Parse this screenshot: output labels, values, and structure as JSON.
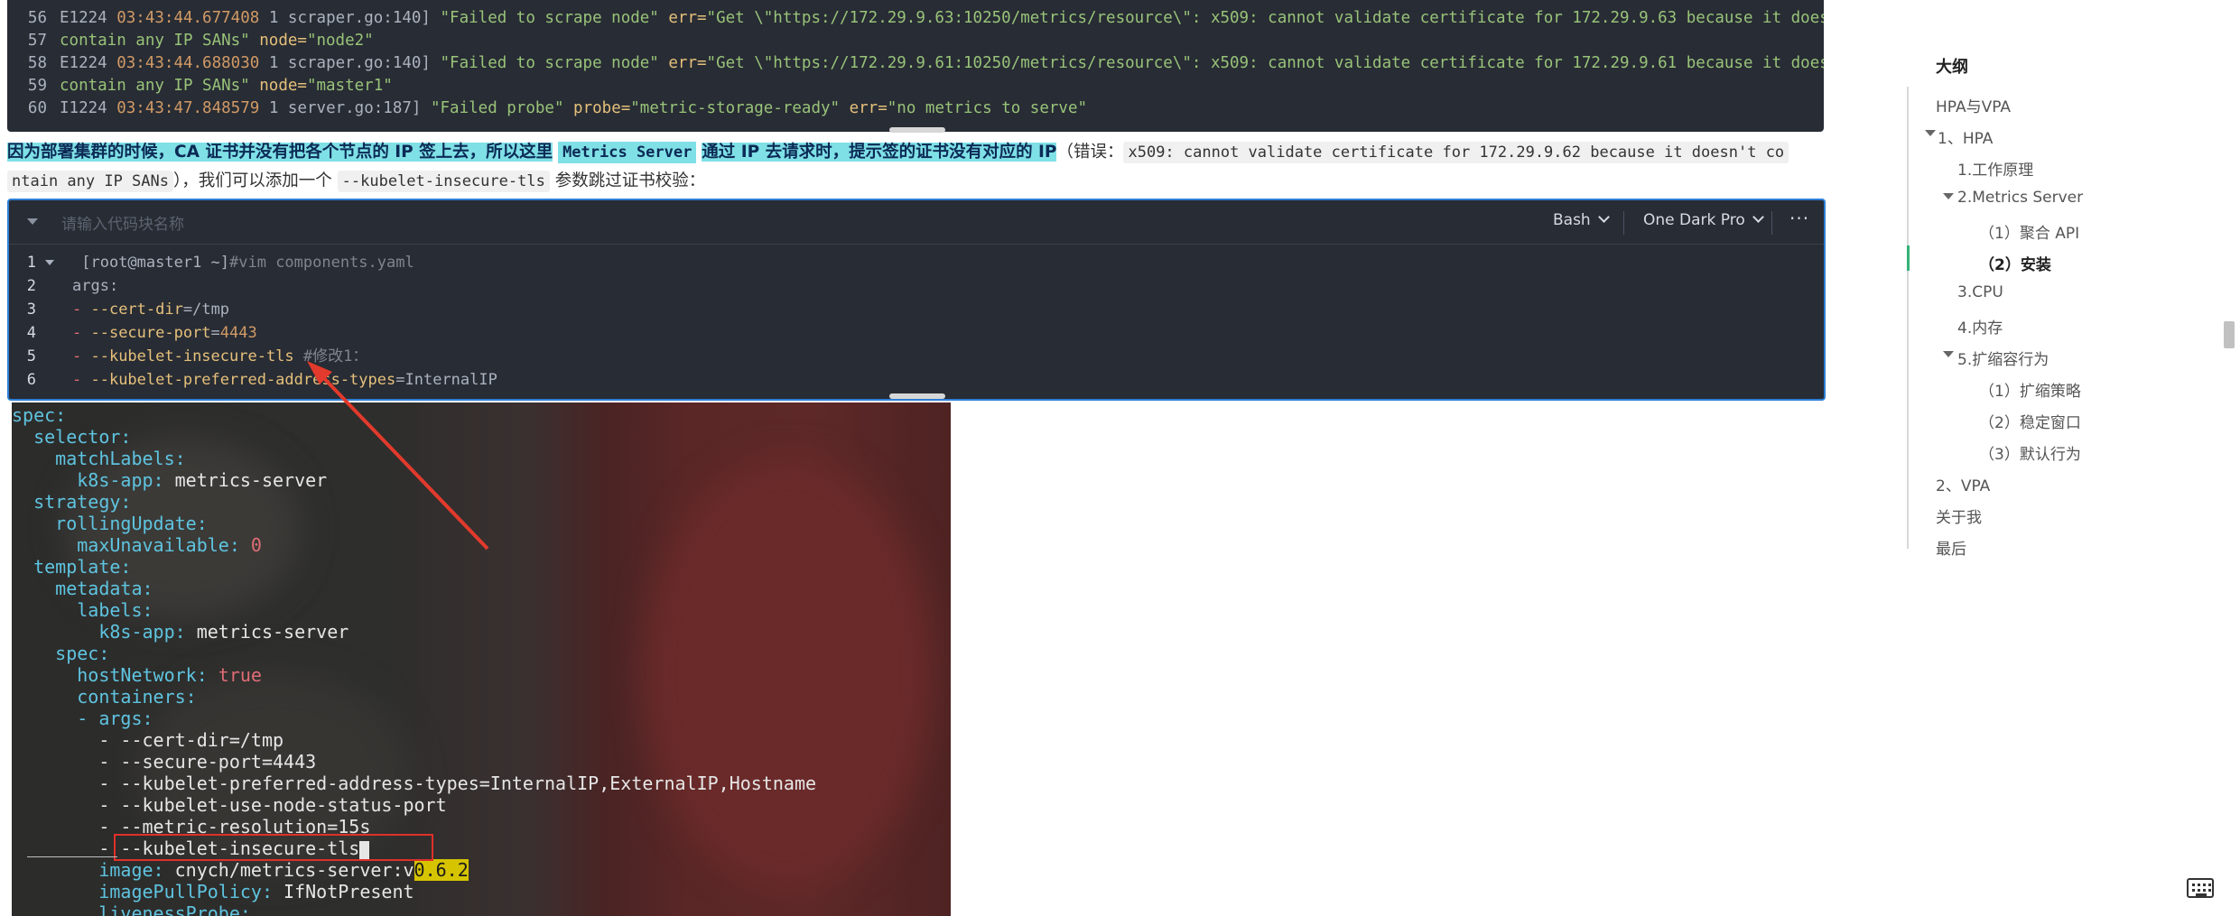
{
  "log": {
    "lines": [
      {
        "no": "56",
        "level": "E1224",
        "time": "03:43:44.677408",
        "pid": "1",
        "src": "scraper.go:140]",
        "msg": "\"Failed to scrape node\"",
        "errk": "err=",
        "errv": "\"Get \\\"https://172.29.9.63:10250/metrics/resource\\\": x509: cannot validate certificate for 172.29.9.63 because it doesn't",
        "cont": "contain any IP SANs\"",
        "nodek": "node=",
        "nodev": "\"node2\""
      },
      {
        "no": "58",
        "level": "E1224",
        "time": "03:43:44.688030",
        "pid": "1",
        "src": "scraper.go:140]",
        "msg": "\"Failed to scrape node\"",
        "errk": "err=",
        "errv": "\"Get \\\"https://172.29.9.61:10250/metrics/resource\\\": x509: cannot validate certificate for 172.29.9.61 because it doesn't",
        "cont": "contain any IP SANs\"",
        "nodek": "node=",
        "nodev": "\"master1\""
      }
    ],
    "cont_numbers": [
      "57",
      "59"
    ],
    "last": {
      "no": "60",
      "level": "I1224",
      "time": "03:43:47.848579",
      "pid": "1",
      "src": "server.go:187]",
      "msg": "\"Failed probe\"",
      "probek": "probe=",
      "probev": "\"metric-storage-ready\"",
      "errk": "err=",
      "errv": "\"no metrics to serve\""
    }
  },
  "paragraph": {
    "hl1": "因为部署集群的时候，CA 证书并没有把各个节点的 IP 签上去，所以这里",
    "code1": "Metrics Server",
    "hl2": "通过 IP 去请求时，提示签的证书没有对应的 IP",
    "t1": "（错误：",
    "code2a": "x509: cannot validate certificate for 172.29.9.62 because it doesn't co",
    "code2b": "ntain any IP SANs",
    "t2": "），我们可以添加一个",
    "code3": "--kubelet-insecure-tls",
    "t3": "参数跳过证书校验："
  },
  "code_block": {
    "name_placeholder": "请输入代码块名称",
    "language": "Bash",
    "theme": "One Dark Pro",
    "more": "···",
    "lines": [
      {
        "no": "1",
        "prompt": "[root@master1 ~]",
        "rest": "#vim components.yaml"
      },
      {
        "no": "2",
        "text": "args:"
      },
      {
        "no": "3",
        "dash": "- ",
        "opt": "--cert-dir",
        "eq": "=",
        "val": "/tmp"
      },
      {
        "no": "4",
        "dash": "- ",
        "opt": "--secure-port",
        "eq": "=",
        "val": "4443"
      },
      {
        "no": "5",
        "dash": "- ",
        "opt": "--kubelet-insecure-tls",
        "comment": " #修改1："
      },
      {
        "no": "6",
        "dash": "- ",
        "opt": "--kubelet-preferred-address-types",
        "eq": "=",
        "val": "InternalIP"
      }
    ]
  },
  "yaml": {
    "spec": "spec:",
    "selector": "selector:",
    "matchLabels": "matchLabels:",
    "k8sapp": "k8s-app:",
    "metricsServer": "metrics-server",
    "strategy": "strategy:",
    "rollingUpdate": "rollingUpdate:",
    "maxUnavailable": "maxUnavailable:",
    "zero": "0",
    "template": "template:",
    "metadata": "metadata:",
    "labels": "labels:",
    "spec2": "spec:",
    "hostNetwork": "hostNetwork:",
    "true": "true",
    "containers": "containers:",
    "args": "- args:",
    "a1": "- --cert-dir=/tmp",
    "a2": "- --secure-port=4443",
    "a3": "- --kubelet-preferred-address-types=InternalIP,ExternalIP,Hostname",
    "a4": "- --kubelet-use-node-status-port",
    "a5": "- --metric-resolution=15s",
    "a6": "- --kubelet-insecure-tls",
    "image": "image:",
    "imageVal": "cnych/metrics-server:v",
    "imageVer": "0.6.2",
    "pullPolicy": "imagePullPolicy:",
    "pullVal": "IfNotPresent",
    "liveness": "livenessProbe:"
  },
  "outline": {
    "title": "大纲",
    "items": [
      {
        "label": "HPA与VPA"
      },
      {
        "label": "1、HPA"
      },
      {
        "label": "1.工作原理"
      },
      {
        "label": "2.Metrics Server"
      },
      {
        "label": "（1）聚合 API"
      },
      {
        "label": "（2）安装"
      },
      {
        "label": "3.CPU"
      },
      {
        "label": "4.内存"
      },
      {
        "label": "5.扩缩容行为"
      },
      {
        "label": "（1）扩缩策略"
      },
      {
        "label": "（2）稳定窗口"
      },
      {
        "label": "（3）默认行为"
      },
      {
        "label": "2、VPA"
      },
      {
        "label": "关于我"
      },
      {
        "label": "最后"
      }
    ],
    "active_index": 5,
    "active_color": "#35b378"
  }
}
